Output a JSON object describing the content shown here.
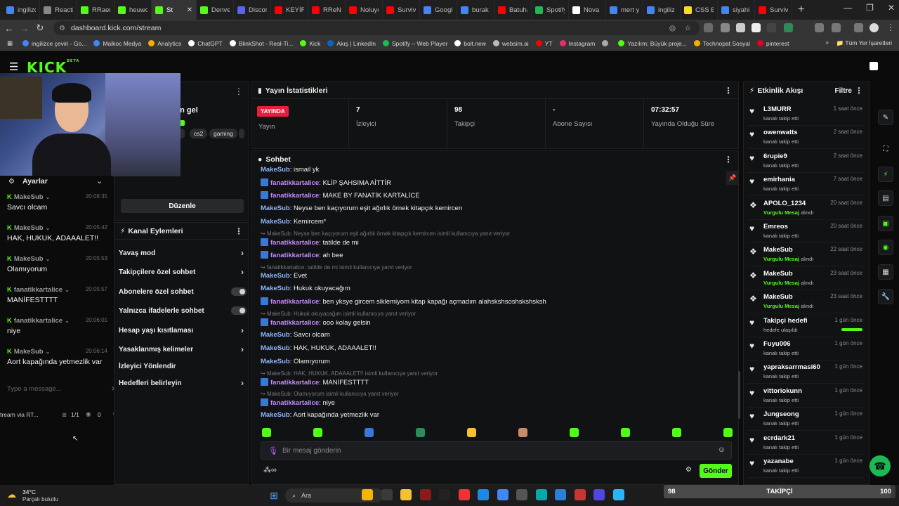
{
  "browser": {
    "tabs": [
      {
        "label": "ingilizce",
        "color": "#4285f4"
      },
      {
        "label": "Reacti",
        "color": "#888888"
      },
      {
        "label": "RRaen",
        "color": "#53fc18"
      },
      {
        "label": "heuwo",
        "color": "#53fc18"
      },
      {
        "label": "St",
        "color": "#53fc18",
        "active": true
      },
      {
        "label": "Denve",
        "color": "#53fc18"
      },
      {
        "label": "Discor",
        "color": "#5865f2"
      },
      {
        "label": "KEYİF",
        "color": "#ff0000"
      },
      {
        "label": "RReN",
        "color": "#ff0000"
      },
      {
        "label": "Noluyo",
        "color": "#ff0000"
      },
      {
        "label": "Surviv",
        "color": "#ff0000"
      },
      {
        "label": "Googl",
        "color": "#4285f4"
      },
      {
        "label": "burak",
        "color": "#4285f4"
      },
      {
        "label": "Batuha",
        "color": "#ff0000"
      },
      {
        "label": "Spotify",
        "color": "#1db954"
      },
      {
        "label": "Nova",
        "color": "#ffffff"
      },
      {
        "label": "mert y",
        "color": "#4285f4"
      },
      {
        "label": "ingiliz",
        "color": "#4285f4"
      },
      {
        "label": "CSS BC",
        "color": "#f7df1e"
      },
      {
        "label": "siyahi",
        "color": "#4285f4"
      },
      {
        "label": "Surviv",
        "color": "#ff0000"
      }
    ],
    "tab_close": "✕",
    "new_tab": "+",
    "url": "dashboard.kick.com/stream",
    "bookmarks": [
      {
        "label": "ingilizce çeviri - Go...",
        "color": "#4285f4"
      },
      {
        "label": "Malkoc Medya",
        "color": "#4285f4"
      },
      {
        "label": "Analytics",
        "color": "#f9ab00"
      },
      {
        "label": "ChatGPT",
        "color": "#ffffff"
      },
      {
        "label": "BlinkShot - Real-Ti...",
        "color": "#ffffff"
      },
      {
        "label": "Kick",
        "color": "#53fc18"
      },
      {
        "label": "Akış | LinkedIn",
        "color": "#0a66c2"
      },
      {
        "label": "Spotify – Web Player",
        "color": "#1db954"
      },
      {
        "label": "bolt.new",
        "color": "#ffffff"
      },
      {
        "label": "websim.ai",
        "color": "#bbbbbb"
      },
      {
        "label": "YT",
        "color": "#ff0000"
      },
      {
        "label": "Instagram",
        "color": "#e1306c"
      },
      {
        "label": "",
        "color": "#aaaaaa"
      },
      {
        "label": "Yazılım: Büyük proje...",
        "color": "#53fc18"
      },
      {
        "label": "Technopat Sosyal",
        "color": "#f9ab00"
      },
      {
        "label": "pinterest",
        "color": "#e60023"
      }
    ],
    "bookmarks_all": "Tüm Yer İşaretleri"
  },
  "kick": {
    "logo": "KICK",
    "beta": "BETA"
  },
  "left_panel": {
    "settings_label": "Ayarlar",
    "stream_title_partial": "en gel",
    "messages": [
      {
        "user": "MakeSub",
        "time": "20:08:35",
        "text": "Savcı olcam"
      },
      {
        "user": "MakeSub",
        "time": "20:05:42",
        "text": "HAK, HUKUK, ADAAALET!!"
      },
      {
        "user": "MakeSub",
        "time": "20:05:53",
        "text": "Olamıyorum"
      },
      {
        "user": "fanatikkartalice",
        "time": "20:05:57",
        "text": "MANİFESTTTT"
      },
      {
        "user": "fanatikkartalice",
        "time": "20:06:01",
        "text": "niye"
      },
      {
        "user": "MakeSub",
        "time": "20:06:14",
        "text": "Aort kapağında yetmezlik var"
      }
    ],
    "input_placeholder": "Type a message...",
    "footer_left": "tream via RT...",
    "footer_count": "1/1",
    "footer_viewers": "0"
  },
  "stream_info": {
    "tags": [
      "cs2",
      "gaming"
    ],
    "edit_button": "Düzenle"
  },
  "channel_actions": {
    "title": "Kanal Eylemleri",
    "items": [
      {
        "label": "Yavaş mod",
        "type": "chevron"
      },
      {
        "label": "Takipçilere özel sohbet",
        "type": "chevron"
      },
      {
        "label": "Abonelere özel sohbet",
        "type": "toggle"
      },
      {
        "label": "Yalnızca ifadelerle sohbet",
        "type": "toggle"
      },
      {
        "label": "Hesap yaşı kısıtlaması",
        "type": "chevron"
      },
      {
        "label": "Yasaklanmış kelimeler",
        "type": "chevron"
      },
      {
        "label": "İzleyici Yönlendir",
        "type": "none"
      },
      {
        "label": "Hedefleri belirleyin",
        "type": "chevron"
      }
    ],
    "chevron": "›"
  },
  "stats": {
    "title": "Yayın İstatistikleri",
    "live_badge": "YAYINDA",
    "live_label": "Yayın",
    "viewers": {
      "value": "7",
      "label": "İzleyici"
    },
    "followers": {
      "value": "98",
      "label": "Takipçi"
    },
    "subs": {
      "value": "-",
      "label": "Abone Sayısı"
    },
    "uptime": {
      "value": "07:32:57",
      "label": "Yayında Olduğu Süre"
    }
  },
  "chat": {
    "title": "Sohbet",
    "lines": [
      {
        "kind": "msg",
        "user": "MakeSub",
        "role": "ms",
        "text": "ismail yk"
      },
      {
        "kind": "msg",
        "user": "fanatikkartalice",
        "role": "fk",
        "text": "KLİP ŞAHSIMA AİTTİR"
      },
      {
        "kind": "msg",
        "user": "fanatikkartalice",
        "role": "fk",
        "text": "MAKE BY FANATİK KARTALİCE"
      },
      {
        "kind": "msg",
        "user": "MakeSub",
        "role": "ms",
        "text": "Neyse ben kaçıyorum eşit ağırlık örnek kitapçık kemircen"
      },
      {
        "kind": "msg",
        "user": "MakeSub",
        "role": "ms",
        "text": "Kemircem*"
      },
      {
        "kind": "reply",
        "text": "MakeSub: Neyse ben kaçıyorum eşit ağırlık örnek kitapçık kemircen isimli kullanıcıya yanıt veriyor"
      },
      {
        "kind": "msg",
        "user": "fanatikkartalice",
        "role": "fk",
        "text": "tatilde de mi"
      },
      {
        "kind": "msg",
        "user": "fanatikkartalice",
        "role": "fk",
        "text": "ah bee"
      },
      {
        "kind": "reply",
        "text": "fanatikkartalice: tatilde de mi isimli kullanıcıya yanıt veriyor"
      },
      {
        "kind": "msg",
        "user": "MakeSub",
        "role": "ms",
        "text": "Evet"
      },
      {
        "kind": "msg",
        "user": "MakeSub",
        "role": "ms",
        "text": "Hukuk okuyacağım"
      },
      {
        "kind": "msg",
        "user": "fanatikkartalice",
        "role": "fk",
        "text": "ben yksye gircem siklemiyom kitap kapağı açmadım alahskshsoshskshsksh"
      },
      {
        "kind": "reply",
        "text": "MakeSub: Hukuk okuyacağım isimli kullanıcıya yanıt veriyor"
      },
      {
        "kind": "msg",
        "user": "fanatikkartalice",
        "role": "fk",
        "text": "ooo kolay gelsin"
      },
      {
        "kind": "msg",
        "user": "MakeSub",
        "role": "ms",
        "text": "Savcı olcam"
      },
      {
        "kind": "msg",
        "user": "MakeSub",
        "role": "ms",
        "text": "HAK, HUKUK, ADAAALET!!"
      },
      {
        "kind": "msg",
        "user": "MakeSub",
        "role": "ms",
        "text": "Olamıyorum"
      },
      {
        "kind": "reply",
        "text": "MakeSub: HAK, HUKUK, ADAAALET!! isimli kullanıcıya yanıt veriyor"
      },
      {
        "kind": "msg",
        "user": "fanatikkartalice",
        "role": "fk",
        "text": "MANİFESTTTT"
      },
      {
        "kind": "reply",
        "text": "MakeSub: Olamıyorum isimli kullanıcıya yanıt veriyor"
      },
      {
        "kind": "msg",
        "user": "fanatikkartalice",
        "role": "fk",
        "text": "niye"
      },
      {
        "kind": "msg",
        "user": "MakeSub",
        "role": "ms",
        "text": "Aort kapağında yetmezlik var"
      }
    ],
    "emote_colors": [
      "#53fc18",
      "#53fc18",
      "#3a78d8",
      "#2e8b57",
      "#f2c230",
      "#c98b6b",
      "#53fc18",
      "#53fc18",
      "#53fc18",
      "#53fc18"
    ],
    "input_placeholder": "Bir mesaj gönderin",
    "send_button": "Gönder"
  },
  "activity": {
    "title": "Etkinlik Akışı",
    "filter": "Filtre",
    "items": [
      {
        "name": "L3MURR",
        "sub": "kanalı takip etti",
        "time": "1 saat önce"
      },
      {
        "name": "owenwatts",
        "sub": "kanalı takip etti",
        "time": "2 saat önce"
      },
      {
        "name": "6rupie9",
        "sub": "kanalı takip etti",
        "time": "2 saat önce"
      },
      {
        "name": "emirhania",
        "sub": "kanalı takip etti",
        "time": "7 saat önce"
      },
      {
        "name": "APOLO_1234",
        "sub_hl": "Vurgulu Mesaj",
        "sub": "alındı",
        "time": "20 saat önce"
      },
      {
        "name": "Emreos",
        "sub": "kanalı takip etti",
        "time": "20 saat önce"
      },
      {
        "name": "MakeSub",
        "sub_hl": "Vurgulu Mesaj",
        "sub": "alındı",
        "time": "22 saat önce"
      },
      {
        "name": "MakeSub",
        "sub_hl": "Vurgulu Mesaj",
        "sub": "alındı",
        "time": "23 saat önce"
      },
      {
        "name": "MakeSub",
        "sub_hl": "Vurgulu Mesaj",
        "sub": "alındı",
        "time": "23 saat önce"
      },
      {
        "name": "Takipçi hedefi",
        "sub": "hedefe ulaşıldı",
        "time": "1 gün önce"
      },
      {
        "name": "Fuyu006",
        "sub": "kanalı takip etti",
        "time": "1 gün önce"
      },
      {
        "name": "yapraksarrmasi60",
        "sub": "kanalı takip etti",
        "time": "1 gün önce"
      },
      {
        "name": "vittoriokunn",
        "sub": "kanalı takip etti",
        "time": "1 gün önce"
      },
      {
        "name": "Jungseong",
        "sub": "kanalı takip etti",
        "time": "1 gün önce"
      },
      {
        "name": "ecrdark21",
        "sub": "kanalı takip etti",
        "time": "1 gün önce"
      },
      {
        "name": "yazanabe",
        "sub": "kanalı takip etti",
        "time": "1 gün önce"
      }
    ]
  },
  "goal_bar": {
    "current": "98",
    "label": "TAKİPÇİ",
    "target": "100",
    "progress": 0.98
  },
  "taskbar": {
    "weather_temp": "34°C",
    "weather_desc": "Parçalı bulutlu",
    "search": "Ara"
  }
}
